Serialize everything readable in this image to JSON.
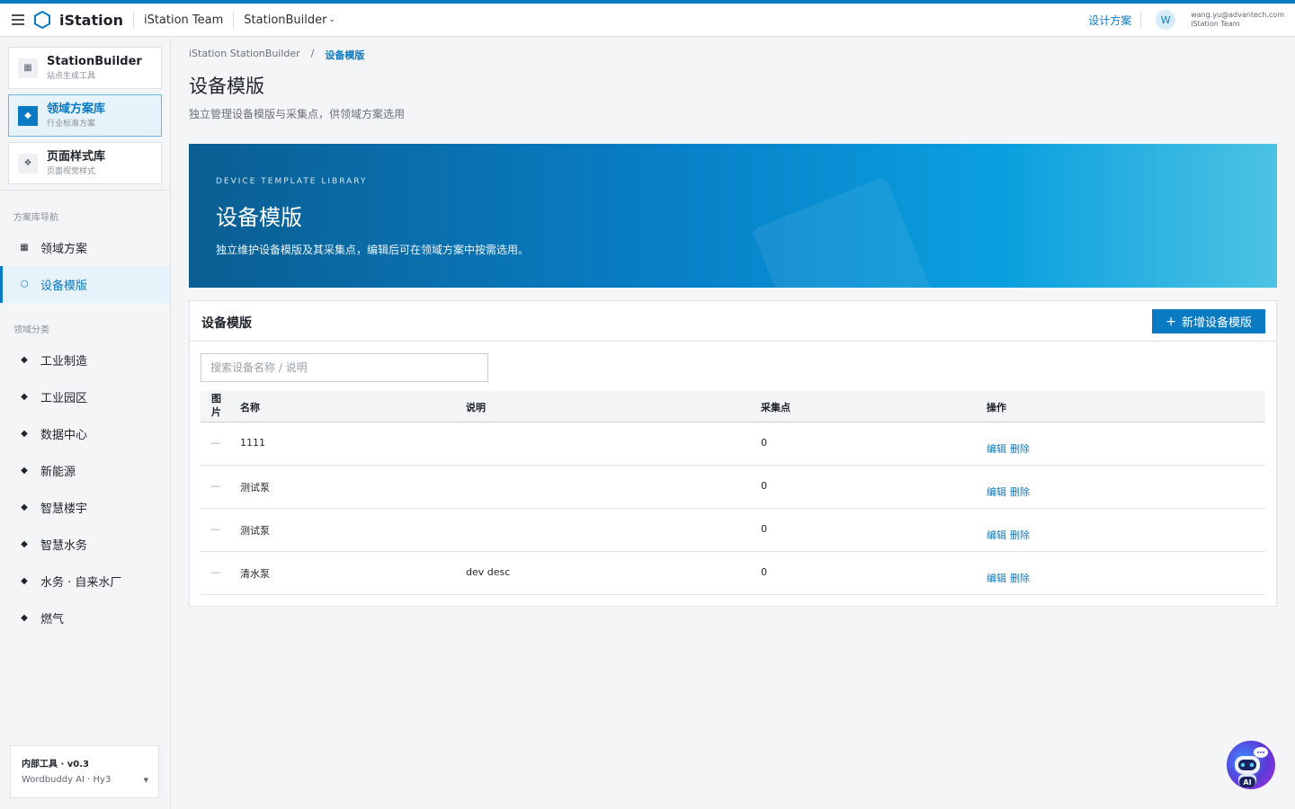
{
  "topbar": {
    "brand": "iStation",
    "team": "iStation Team",
    "product": "StationBuilder",
    "design_link": "设计方案",
    "avatar_letter": "W",
    "user_email": "wang.yu@advantech.com",
    "user_team": "iStation Team"
  },
  "sidebar": {
    "apps": [
      {
        "name": "StationBuilder",
        "sub": "站点生成工具",
        "icon": "grid-icon"
      },
      {
        "name": "领域方案库",
        "sub": "行业标准方案",
        "icon": "diamond-icon"
      },
      {
        "name": "页面样式库",
        "sub": "页面视觉样式",
        "icon": "layers-icon"
      }
    ],
    "nav_section": "方案库导航",
    "nav": [
      {
        "label": "领域方案",
        "icon": "grid-icon"
      },
      {
        "label": "设备模版",
        "icon": "hexagon-icon"
      }
    ],
    "category_section": "领域分类",
    "categories": [
      {
        "label": "工业制造"
      },
      {
        "label": "工业园区"
      },
      {
        "label": "数据中心"
      },
      {
        "label": "新能源"
      },
      {
        "label": "智慧楼宇"
      },
      {
        "label": "智慧水务"
      },
      {
        "label": "水务 · 自来水厂"
      },
      {
        "label": "燃气"
      }
    ],
    "version": {
      "title": "内部工具 · v0.3",
      "model": "Wordbuddy AI · Hy3"
    }
  },
  "breadcrumb": {
    "root": "iStation StationBuilder",
    "sep": "/",
    "current": "设备模版"
  },
  "page": {
    "title": "设备模版",
    "subtitle": "独立管理设备模版与采集点，供领域方案选用"
  },
  "banner": {
    "eyebrow": "DEVICE TEMPLATE LIBRARY",
    "title": "设备模版",
    "desc": "独立维护设备模版及其采集点，编辑后可在领域方案中按需选用。"
  },
  "card": {
    "title": "设备模版",
    "add_button": "新增设备模版",
    "search_placeholder": "搜索设备名称 / 说明",
    "columns": {
      "image": "图片",
      "name": "名称",
      "desc": "说明",
      "points": "采集点",
      "actions": "操作"
    },
    "rows": [
      {
        "image": "—",
        "name": "1111",
        "desc": "",
        "points": "0",
        "edit": "编辑",
        "delete": "删除"
      },
      {
        "image": "—",
        "name": "测试泵",
        "desc": "",
        "points": "0",
        "edit": "编辑",
        "delete": "删除"
      },
      {
        "image": "—",
        "name": "测试泵",
        "desc": "",
        "points": "0",
        "edit": "编辑",
        "delete": "删除"
      },
      {
        "image": "—",
        "name": "清水泵",
        "desc": "dev desc",
        "points": "0",
        "edit": "编辑",
        "delete": "删除"
      }
    ]
  },
  "ai_bot": {
    "label": "AI",
    "icon": "robot-icon"
  },
  "colors": {
    "accent": "#0a7ac2",
    "banner_start": "#0b5e92",
    "banner_end": "#4cc3e3"
  }
}
